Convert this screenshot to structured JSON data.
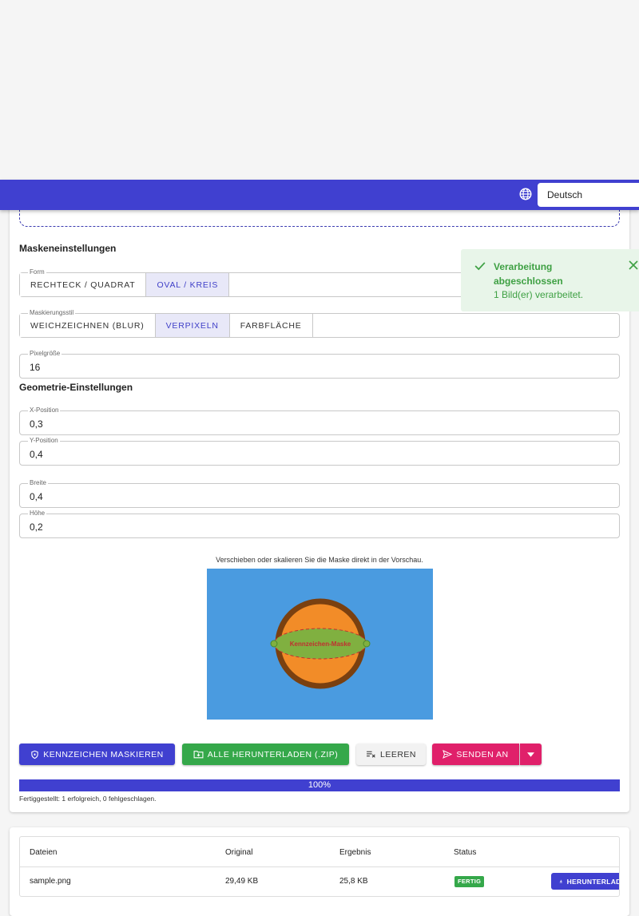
{
  "header": {
    "language": "Deutsch"
  },
  "mask_settings": {
    "title": "Maskeneinstellungen",
    "shape": {
      "legend": "Form",
      "options": [
        "RECHTECK / QUADRAT",
        "OVAL / KREIS"
      ],
      "selected": "OVAL / KREIS"
    },
    "style": {
      "legend": "Maskierungsstil",
      "options": [
        "WEICHZEICHNEN (BLUR)",
        "VERPIXELN",
        "FARBFLÄCHE"
      ],
      "selected": "VERPIXELN"
    },
    "pixel_size": {
      "legend": "Pixelgröße",
      "value": "16"
    }
  },
  "geometry": {
    "title": "Geometrie-Einstellungen",
    "x": {
      "legend": "X-Position",
      "value": "0,3"
    },
    "y": {
      "legend": "Y-Position",
      "value": "0,4"
    },
    "width": {
      "legend": "Breite",
      "value": "0,4"
    },
    "height": {
      "legend": "Höhe",
      "value": "0,2"
    }
  },
  "preview": {
    "caption": "Verschieben oder skalieren Sie die Maske direkt in der Vorschau.",
    "mask_label": "Kennzeichen-Maske"
  },
  "actions": {
    "mask": "KENNZEICHEN MASKIEREN",
    "download_all": "ALLE HERUNTERLADEN (.ZIP)",
    "clear": "LEEREN",
    "send": "SENDEN AN"
  },
  "progress": {
    "percent_label": "100%",
    "value": 1.0,
    "summary": "Fertiggestellt: 1 erfolgreich, 0 fehlgeschlagen."
  },
  "files_table": {
    "headers": [
      "Dateien",
      "Original",
      "Ergebnis",
      "Status"
    ],
    "rows": [
      {
        "name": "sample.png",
        "original": "29,49 KB",
        "result": "25,8 KB",
        "status": "FERTIG",
        "action": "HERUNTERLADEN"
      }
    ]
  },
  "toast": {
    "title": "Verarbeitung abgeschlossen",
    "message": "1 Bild(er) verarbeitet."
  },
  "colors": {
    "primary": "#4040d0",
    "success": "#35a84a",
    "accent": "#e0206a",
    "preview_bg": "#4a9be0",
    "ball_orange": "#f28c28",
    "ball_border": "#7a4010",
    "mask_green": "#80b040"
  }
}
